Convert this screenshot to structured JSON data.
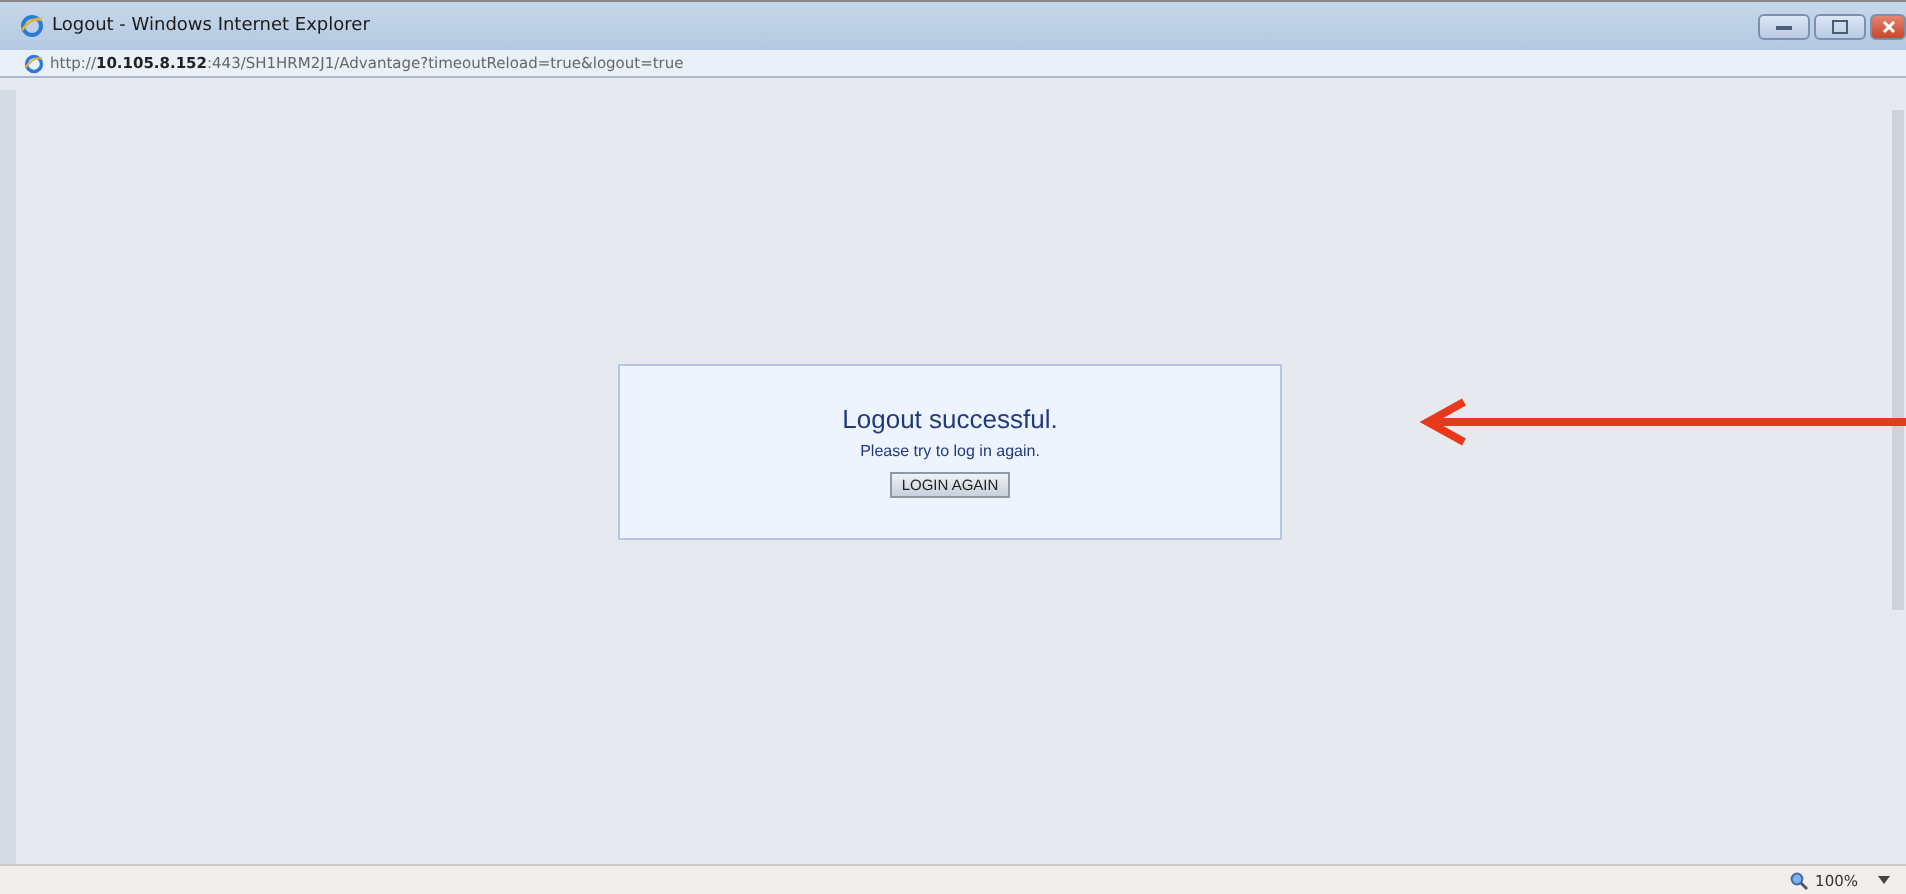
{
  "window": {
    "title": "Logout - Windows Internet Explorer"
  },
  "address_bar": {
    "url": "http://**10.105.8.152**:443/SH1HRM2J1/Advantage?timeoutReload=true&logout=true"
  },
  "message_box": {
    "heading": "Logout successful.",
    "text": "Please try to log in again.",
    "button": "LOGIN AGAIN"
  },
  "status_bar": {
    "zoom": "100%"
  }
}
